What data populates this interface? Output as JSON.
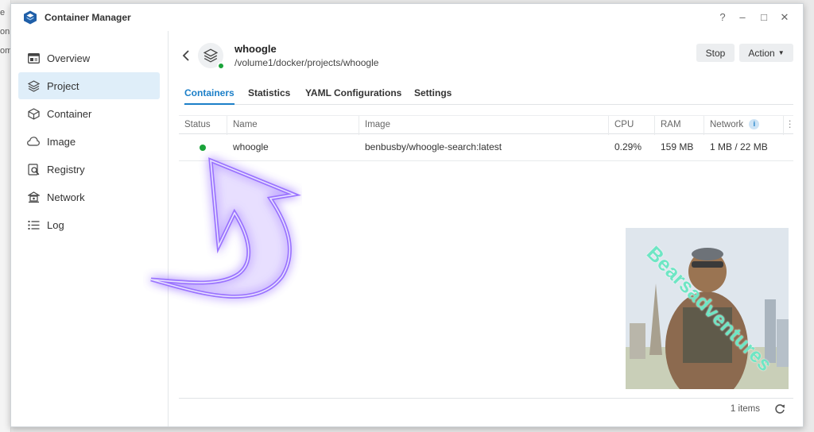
{
  "app": {
    "title": "Container Manager"
  },
  "window_controls": {
    "help": "?",
    "minimize": "–",
    "maximize": "□",
    "close": "✕"
  },
  "behind_text": [
    "e",
    "on",
    "om"
  ],
  "sidebar": {
    "items": [
      {
        "label": "Overview",
        "icon": "overview-icon",
        "active": false
      },
      {
        "label": "Project",
        "icon": "project-icon",
        "active": true
      },
      {
        "label": "Container",
        "icon": "container-icon",
        "active": false
      },
      {
        "label": "Image",
        "icon": "image-icon",
        "active": false
      },
      {
        "label": "Registry",
        "icon": "registry-icon",
        "active": false
      },
      {
        "label": "Network",
        "icon": "network-icon",
        "active": false
      },
      {
        "label": "Log",
        "icon": "log-icon",
        "active": false
      }
    ]
  },
  "project": {
    "name": "whoogle",
    "path": "/volume1/docker/projects/whoogle",
    "status_color": "#1aa33a"
  },
  "buttons": {
    "stop": "Stop",
    "action": "Action"
  },
  "tabs": [
    {
      "label": "Containers",
      "active": true
    },
    {
      "label": "Statistics",
      "active": false
    },
    {
      "label": "YAML Configurations",
      "active": false
    },
    {
      "label": "Settings",
      "active": false
    }
  ],
  "table": {
    "columns": [
      "Status",
      "Name",
      "Image",
      "CPU",
      "RAM",
      "Network"
    ],
    "rows": [
      {
        "status": "running",
        "name": "whoogle",
        "image": "benbusby/whoogle-search:latest",
        "cpu": "0.29%",
        "ram": "159 MB",
        "network": "1 MB / 22 MB"
      }
    ]
  },
  "footer": {
    "items_count": "1 items"
  },
  "watermark": {
    "text": "Bearsadventures",
    "color": "#6ee6c4"
  },
  "colors": {
    "accent": "#1b7fc8",
    "active_bg": "#dfeef9",
    "running": "#1aa33a",
    "arrow_glow": "#8a5cff"
  }
}
